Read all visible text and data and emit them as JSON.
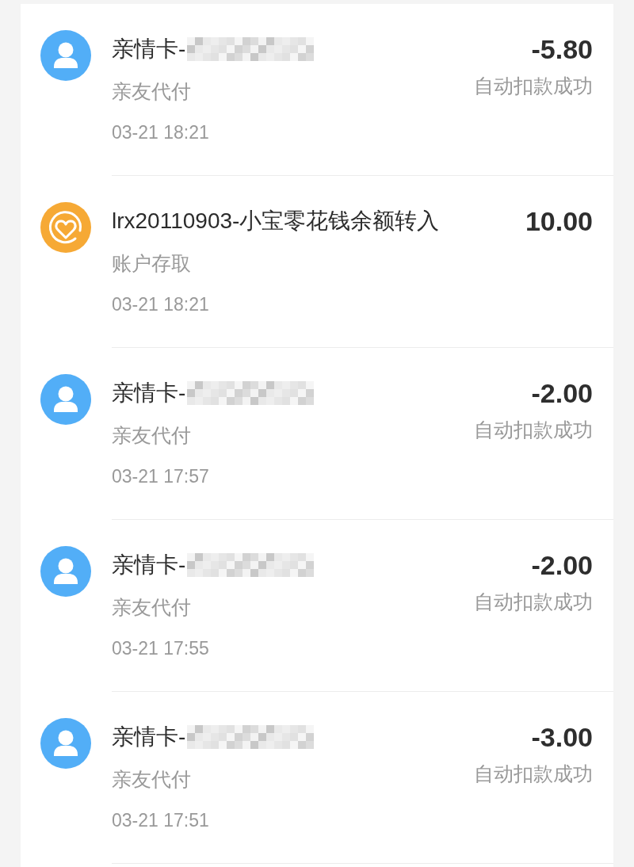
{
  "transactions": [
    {
      "kind": "family_card",
      "title": "亲情卡-",
      "redacted": true,
      "category": "亲友代付",
      "time": "03-21 18:21",
      "amount": "-5.80",
      "status": "自动扣款成功"
    },
    {
      "kind": "deposit",
      "title": "lrx20110903-小宝零花钱余额转入",
      "category": "账户存取",
      "time": "03-21 18:21",
      "amount": "10.00"
    },
    {
      "kind": "family_card",
      "title": "亲情卡-",
      "redacted": true,
      "category": "亲友代付",
      "time": "03-21 17:57",
      "amount": "-2.00",
      "status": "自动扣款成功"
    },
    {
      "kind": "family_card",
      "title": "亲情卡-",
      "redacted": true,
      "category": "亲友代付",
      "time": "03-21 17:55",
      "amount": "-2.00",
      "status": "自动扣款成功"
    },
    {
      "kind": "family_card",
      "title": "亲情卡-",
      "redacted": true,
      "category": "亲友代付",
      "time": "03-21 17:51",
      "amount": "-3.00",
      "status": "自动扣款成功"
    }
  ]
}
